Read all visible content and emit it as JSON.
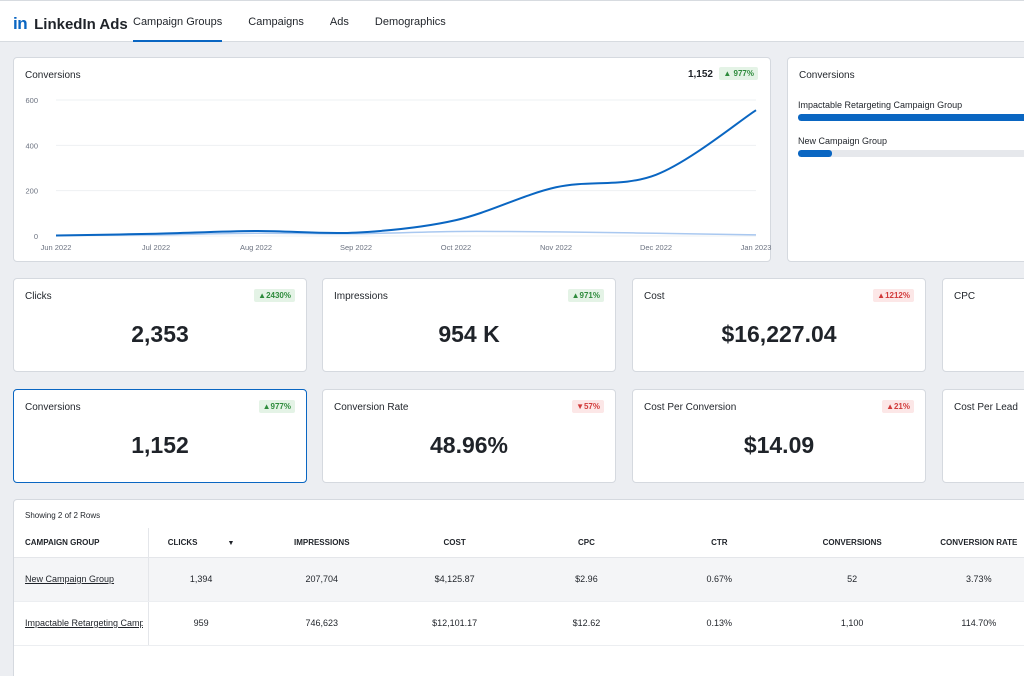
{
  "brand": {
    "logo": "in",
    "name": "LinkedIn Ads"
  },
  "tabs": [
    "Campaign Groups",
    "Campaigns",
    "Ads",
    "Demographics"
  ],
  "chart": {
    "title": "Conversions",
    "total": "1,152",
    "change": "977%"
  },
  "chart_data": {
    "type": "line",
    "x": [
      "Jun 2022",
      "Jul 2022",
      "Aug 2022",
      "Sep 2022",
      "Oct 2022",
      "Nov 2022",
      "Dec 2022",
      "Jan 2023"
    ],
    "ylim": [
      0,
      600
    ],
    "yticks": [
      "0",
      "200",
      "400",
      "600"
    ],
    "series": [
      {
        "values": [
          2,
          10,
          22,
          15,
          70,
          215,
          270,
          555
        ],
        "color": "#0a66c2"
      },
      {
        "values": [
          2,
          5,
          12,
          10,
          20,
          18,
          12,
          5
        ],
        "color": "#a9c8f0"
      }
    ]
  },
  "groups_card": {
    "title": "Conversions",
    "bars": [
      {
        "label": "Impactable Retargeting Campaign Group",
        "value": 1100,
        "fraction": 1.0
      },
      {
        "label": "New Campaign Group",
        "value": 52,
        "fraction": 0.14
      }
    ]
  },
  "metrics": [
    {
      "label": "Clicks",
      "value": "2,353",
      "change": "2430%",
      "dir": "up"
    },
    {
      "label": "Impressions",
      "value": "954 K",
      "change": "971%",
      "dir": "up"
    },
    {
      "label": "Cost",
      "value": "$16,227.04",
      "change": "1212%",
      "dir": "down"
    },
    {
      "label": "CPC"
    },
    {
      "label": "Conversions",
      "value": "1,152",
      "change": "977%",
      "dir": "up"
    },
    {
      "label": "Conversion Rate",
      "value": "48.96%",
      "change": "57%",
      "dir": "down"
    },
    {
      "label": "Cost Per Conversion",
      "value": "$14.09",
      "change": "21%",
      "dir": "up-red"
    },
    {
      "label": "Cost Per Lead"
    }
  ],
  "arrows": {
    "up": "▲",
    "down": "▼"
  },
  "table": {
    "info": "Showing 2 of 2 Rows",
    "sort_icon": "▼",
    "headers": [
      "CAMPAIGN GROUP",
      "CLICKS",
      "IMPRESSIONS",
      "COST",
      "CPC",
      "CTR",
      "CONVERSIONS",
      "CONVERSION RATE"
    ],
    "rows": [
      [
        "New Campaign Group",
        "1,394",
        "207,704",
        "$4,125.87",
        "$2.96",
        "0.67%",
        "52",
        "3.73%"
      ],
      [
        "Impactable Retargeting Campaign Group",
        "959",
        "746,623",
        "$12,101.17",
        "$12.62",
        "0.13%",
        "1,100",
        "114.70%"
      ]
    ]
  }
}
